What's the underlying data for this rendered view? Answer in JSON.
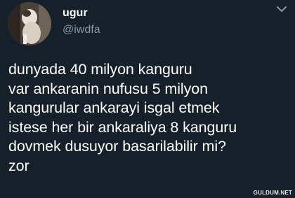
{
  "tweet": {
    "author": {
      "name": "ugur",
      "handle": "@iwdfa",
      "avatar_icon": "profile-photo-avatar"
    },
    "menu_icon": "chevron-down-icon",
    "text": "dunyada 40 milyon kanguru\nvar ankaranin nufusu 5 milyon\nkangurular ankarayi isgal etmek\nistese her bir ankaraliya 8 kanguru\ndovmek dusuyor basarilabilir mi?\nzor"
  },
  "watermark": {
    "text": "GULDUM.NET"
  },
  "colors": {
    "background": "#15202b",
    "primary_text": "#ffffff",
    "secondary_text": "#8899a6"
  }
}
